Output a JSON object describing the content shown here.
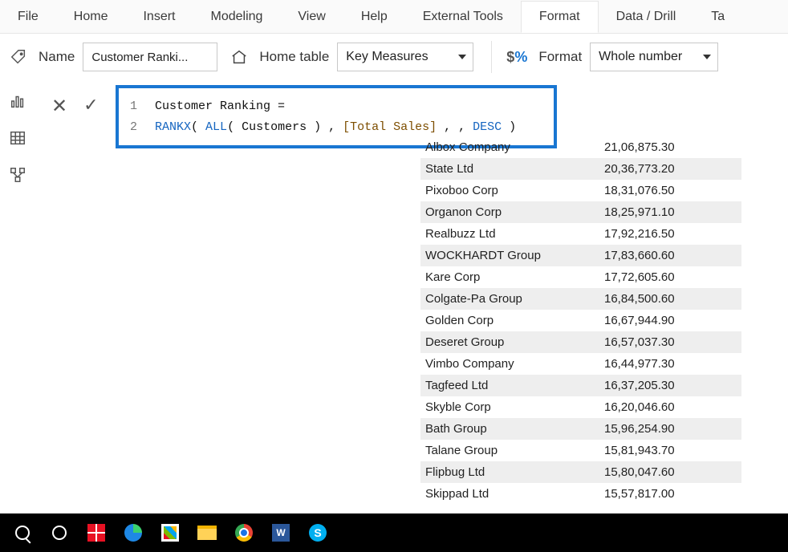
{
  "ribbon": {
    "tabs": [
      "File",
      "Home",
      "Insert",
      "Modeling",
      "View",
      "Help",
      "External Tools",
      "Format",
      "Data / Drill",
      "Ta"
    ],
    "active_index": 7
  },
  "properties": {
    "name_label": "Name",
    "name_value": "Customer Ranki...",
    "home_table_label": "Home table",
    "home_table_value": "Key Measures",
    "format_label": "Format",
    "format_value": "Whole number"
  },
  "formula": {
    "lines": {
      "l1_num": "1",
      "l1_text1": "Customer Ranking =",
      "l2_num": "2",
      "l2_fn": "RANKX",
      "l2_p1": "( ",
      "l2_all": "ALL",
      "l2_p2": "( ",
      "l2_tbl": "Customers",
      "l2_p3": " ) , ",
      "l2_col": "[Total Sales]",
      "l2_p4": " , , ",
      "l2_desc": "DESC",
      "l2_p5": " )"
    }
  },
  "table": {
    "rows": [
      {
        "name": "Albox Company",
        "value": "21,06,875.30"
      },
      {
        "name": "State Ltd",
        "value": "20,36,773.20"
      },
      {
        "name": "Pixoboo Corp",
        "value": "18,31,076.50"
      },
      {
        "name": "Organon Corp",
        "value": "18,25,971.10"
      },
      {
        "name": "Realbuzz Ltd",
        "value": "17,92,216.50"
      },
      {
        "name": "WOCKHARDT Group",
        "value": "17,83,660.60"
      },
      {
        "name": "Kare Corp",
        "value": "17,72,605.60"
      },
      {
        "name": "Colgate-Pa Group",
        "value": "16,84,500.60"
      },
      {
        "name": "Golden Corp",
        "value": "16,67,944.90"
      },
      {
        "name": "Deseret Group",
        "value": "16,57,037.30"
      },
      {
        "name": "Vimbo Company",
        "value": "16,44,977.30"
      },
      {
        "name": "Tagfeed Ltd",
        "value": "16,37,205.30"
      },
      {
        "name": "Skyble Corp",
        "value": "16,20,046.60"
      },
      {
        "name": "Bath Group",
        "value": "15,96,254.90"
      },
      {
        "name": "Talane Group",
        "value": "15,81,943.70"
      },
      {
        "name": "Flipbug Ltd",
        "value": "15,80,047.60"
      },
      {
        "name": "Skippad Ltd",
        "value": "15,57,817.00"
      }
    ]
  },
  "taskbar": {
    "word_letter": "W",
    "skype_letter": "S"
  }
}
